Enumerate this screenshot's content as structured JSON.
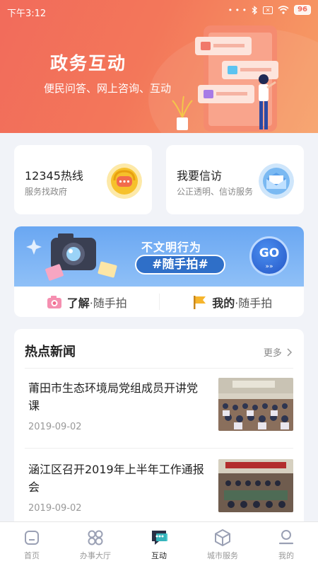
{
  "status_bar": {
    "time": "下午3:12",
    "dots": "• • •",
    "battery": "96"
  },
  "hero": {
    "title": "政务互动",
    "subtitle": "便民问答、网上咨询、互动"
  },
  "cards": [
    {
      "title": "12345热线",
      "subtitle": "服务找政府",
      "icon": "chat-bubble-icon",
      "color": "#f6c12b"
    },
    {
      "title": "我要信访",
      "subtitle": "公正透明、信访服务",
      "icon": "envelope-icon",
      "color": "#5aa9ef"
    }
  ],
  "photo_banner": {
    "line1": "不文明行为",
    "line2": "#随手拍#",
    "go_label": "GO",
    "go_arrows": "»»",
    "links": [
      {
        "bold": "了解",
        "rest": "·随手拍",
        "icon": "camera-icon"
      },
      {
        "bold": "我的",
        "rest": "·随手拍",
        "icon": "flag-icon"
      }
    ]
  },
  "news": {
    "title": "热点新闻",
    "more": "更多",
    "items": [
      {
        "title": "莆田市生态环境局党组成员开讲党课",
        "date": "2019-09-02"
      },
      {
        "title": "涵江区召开2019年上半年工作通报会",
        "date": "2019-09-02"
      }
    ]
  },
  "nav": [
    {
      "label": "首页",
      "icon": "home-icon",
      "active": false
    },
    {
      "label": "办事大厅",
      "icon": "grid-icon",
      "active": false
    },
    {
      "label": "互动",
      "icon": "chat-icon",
      "active": true
    },
    {
      "label": "城市服务",
      "icon": "cube-icon",
      "active": false
    },
    {
      "label": "我的",
      "icon": "user-icon",
      "active": false
    }
  ],
  "colors": {
    "header_start": "#f26b5b",
    "header_end": "#f7a066",
    "banner_blue": "#6aa7f2",
    "active_nav": "#222222"
  }
}
